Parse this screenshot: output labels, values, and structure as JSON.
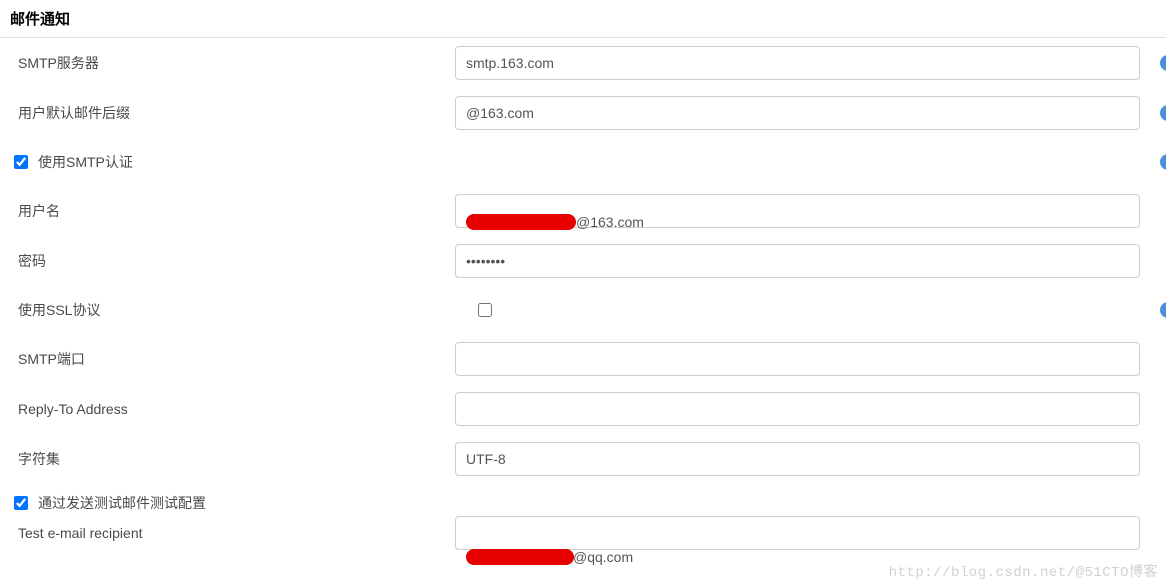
{
  "section": {
    "title": "邮件通知"
  },
  "fields": {
    "smtp_server": {
      "label": "SMTP服务器",
      "value": "smtp.163.com"
    },
    "default_suffix": {
      "label": "用户默认邮件后缀",
      "value": "@163.com"
    },
    "use_smtp_auth": {
      "label": "使用SMTP认证",
      "checked": true
    },
    "username": {
      "label": "用户名",
      "value_visible_part": "@163.com"
    },
    "password": {
      "label": "密码",
      "value": "••••••••"
    },
    "use_ssl": {
      "label": "使用SSL协议",
      "checked": false
    },
    "smtp_port": {
      "label": "SMTP端口",
      "value": ""
    },
    "reply_to": {
      "label": "Reply-To Address",
      "value": ""
    },
    "charset": {
      "label": "字符集",
      "value": "UTF-8"
    },
    "test_config": {
      "label": "通过发送测试邮件测试配置",
      "checked": true
    },
    "test_recipient": {
      "label": "Test e-mail recipient",
      "value_visible_part": "@qq.com"
    }
  },
  "watermark": "http://blog.csdn.net/@51CTO博客"
}
